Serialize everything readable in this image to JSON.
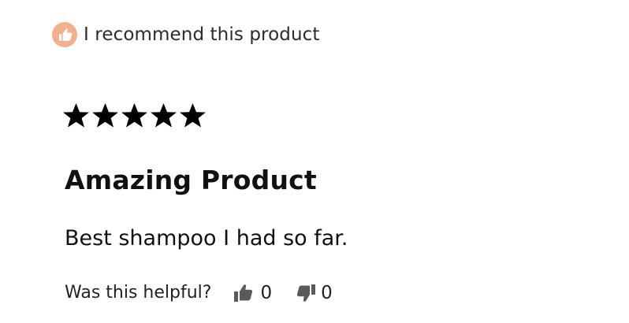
{
  "review": {
    "recommend": {
      "icon": "thumbs-up-icon",
      "icon_color": "#F4B08C",
      "label": "I recommend this product"
    },
    "rating": {
      "stars_filled": 5,
      "stars_total": 5,
      "star_color": "#000000"
    },
    "title": "Amazing Product",
    "body": "Best shampoo I had so far.",
    "helpful": {
      "label": "Was this helpful?",
      "up": {
        "icon": "thumbs-up-icon",
        "count": "0"
      },
      "down": {
        "icon": "thumbs-down-icon",
        "count": "0"
      },
      "icon_color": "#5a5a5a"
    }
  }
}
